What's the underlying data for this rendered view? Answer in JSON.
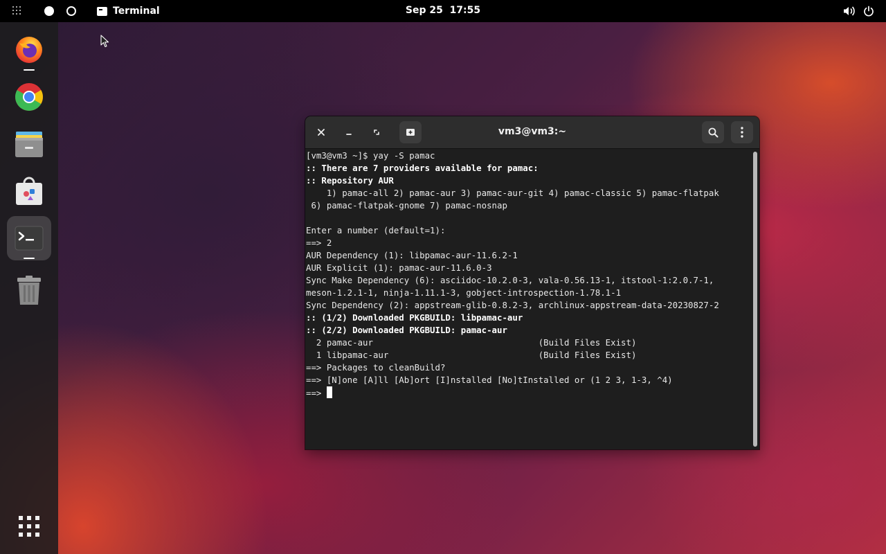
{
  "topbar": {
    "app_name": "Terminal",
    "clock": "Sep 25  17:55",
    "icons": [
      "activities-grid-icon",
      "workspace-active-icon",
      "workspace-inactive-icon",
      "terminal-icon",
      "volume-icon",
      "power-icon"
    ]
  },
  "dock": {
    "items": [
      {
        "name": "Firefox",
        "icon": "firefox-icon",
        "running": true
      },
      {
        "name": "Google Chrome",
        "icon": "chrome-icon",
        "running": false
      },
      {
        "name": "Files",
        "icon": "files-icon",
        "running": false
      },
      {
        "name": "Software",
        "icon": "software-store-icon",
        "running": false
      },
      {
        "name": "Terminal",
        "icon": "terminal-icon",
        "running": true,
        "active": true
      },
      {
        "name": "Trash",
        "icon": "trash-icon",
        "running": false
      }
    ],
    "show_apps_icon": "app-grid-icon"
  },
  "terminal": {
    "title": "vm3@vm3:~",
    "lines": [
      {
        "text": "[vm3@vm3 ~]$ yay -S pamac",
        "bold": false
      },
      {
        "text": ":: There are 7 providers available for pamac:",
        "bold": true
      },
      {
        "text": ":: Repository AUR",
        "bold": true
      },
      {
        "text": "    1) pamac-all 2) pamac-aur 3) pamac-aur-git 4) pamac-classic 5) pamac-flatpak",
        "bold": false
      },
      {
        "text": " 6) pamac-flatpak-gnome 7) pamac-nosnap",
        "bold": false
      },
      {
        "text": "",
        "bold": false
      },
      {
        "text": "Enter a number (default=1):",
        "bold": false
      },
      {
        "text": "==> 2",
        "bold": false
      },
      {
        "text": "AUR Dependency (1): libpamac-aur-11.6.2-1",
        "bold": false
      },
      {
        "text": "AUR Explicit (1): pamac-aur-11.6.0-3",
        "bold": false
      },
      {
        "text": "Sync Make Dependency (6): asciidoc-10.2.0-3, vala-0.56.13-1, itstool-1:2.0.7-1,",
        "bold": false
      },
      {
        "text": "meson-1.2.1-1, ninja-1.11.1-3, gobject-introspection-1.78.1-1",
        "bold": false
      },
      {
        "text": "Sync Dependency (2): appstream-glib-0.8.2-3, archlinux-appstream-data-20230827-2",
        "bold": false
      },
      {
        "text": ":: (1/2) Downloaded PKGBUILD: libpamac-aur",
        "bold": true
      },
      {
        "text": ":: (2/2) Downloaded PKGBUILD: pamac-aur",
        "bold": true
      },
      {
        "text": "  2 pamac-aur                                (Build Files Exist)",
        "bold": false
      },
      {
        "text": "  1 libpamac-aur                             (Build Files Exist)",
        "bold": false
      },
      {
        "text": "==> Packages to cleanBuild?",
        "bold": false
      },
      {
        "text": "==> [N]one [A]ll [Ab]ort [I]nstalled [No]tInstalled or (1 2 3, 1-3, ^4)",
        "bold": false
      }
    ],
    "prompt": "==> "
  }
}
